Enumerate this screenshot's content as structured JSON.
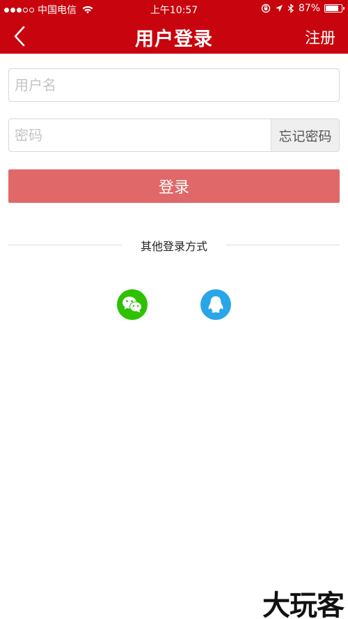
{
  "status_bar": {
    "carrier": "中国电信",
    "time": "上午10:57",
    "battery": "87%",
    "battery_level": 0.87
  },
  "nav": {
    "title": "用户登录",
    "register_label": "注册"
  },
  "form": {
    "username_placeholder": "用户名",
    "password_placeholder": "密码",
    "forgot_label": "忘记密码",
    "login_label": "登录"
  },
  "other_login": {
    "label": "其他登录方式",
    "providers": [
      "wechat-icon",
      "qq-icon"
    ]
  },
  "colors": {
    "header": "#c8050e",
    "login_button": "#e06868",
    "wechat": "#2dc100",
    "qq": "#2aa6e8"
  },
  "watermark": "大玩客"
}
